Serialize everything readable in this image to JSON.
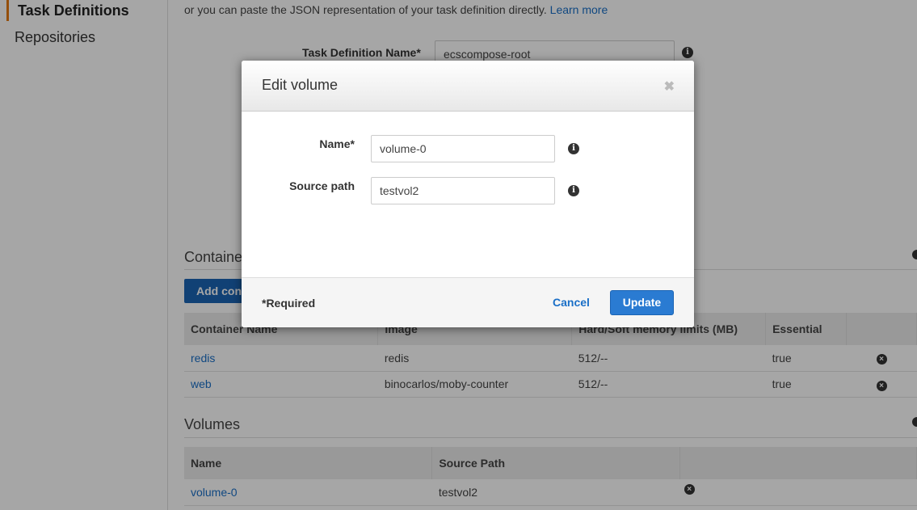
{
  "sidebar": {
    "active_item": "Task Definitions",
    "items": [
      "Repositories"
    ]
  },
  "main": {
    "intro_text": "or you can paste the JSON representation of your task definition directly.",
    "learn_more": "Learn more",
    "task_definition_name_label": "Task Definition Name*",
    "task_definition_name_value": "ecscompose-root",
    "containers_section": {
      "title": "Containe",
      "add_button": "Add con",
      "columns": [
        "Container Name",
        "Image",
        "Hard/Soft memory limits (MB)",
        "Essential"
      ],
      "rows": [
        {
          "name": "redis",
          "image": "redis",
          "memory": "512/--",
          "essential": "true"
        },
        {
          "name": "web",
          "image": "binocarlos/moby-counter",
          "memory": "512/--",
          "essential": "true"
        }
      ]
    },
    "volumes_section": {
      "title": "Volumes",
      "columns": [
        "Name",
        "Source Path"
      ],
      "rows": [
        {
          "name": "volume-0",
          "source_path": "testvol2"
        }
      ]
    }
  },
  "modal": {
    "title": "Edit volume",
    "close_glyph": "✖",
    "name_label": "Name*",
    "name_value": "volume-0",
    "source_path_label": "Source path",
    "source_path_value": "testvol2",
    "required_note": "*Required",
    "cancel_label": "Cancel",
    "update_label": "Update"
  },
  "icons": {
    "info": "info-icon",
    "remove": "remove-x-icon"
  },
  "colors": {
    "link": "#1a6fc7",
    "primary_button": "#2a7bd2",
    "active_nav_accent": "#e47911"
  }
}
